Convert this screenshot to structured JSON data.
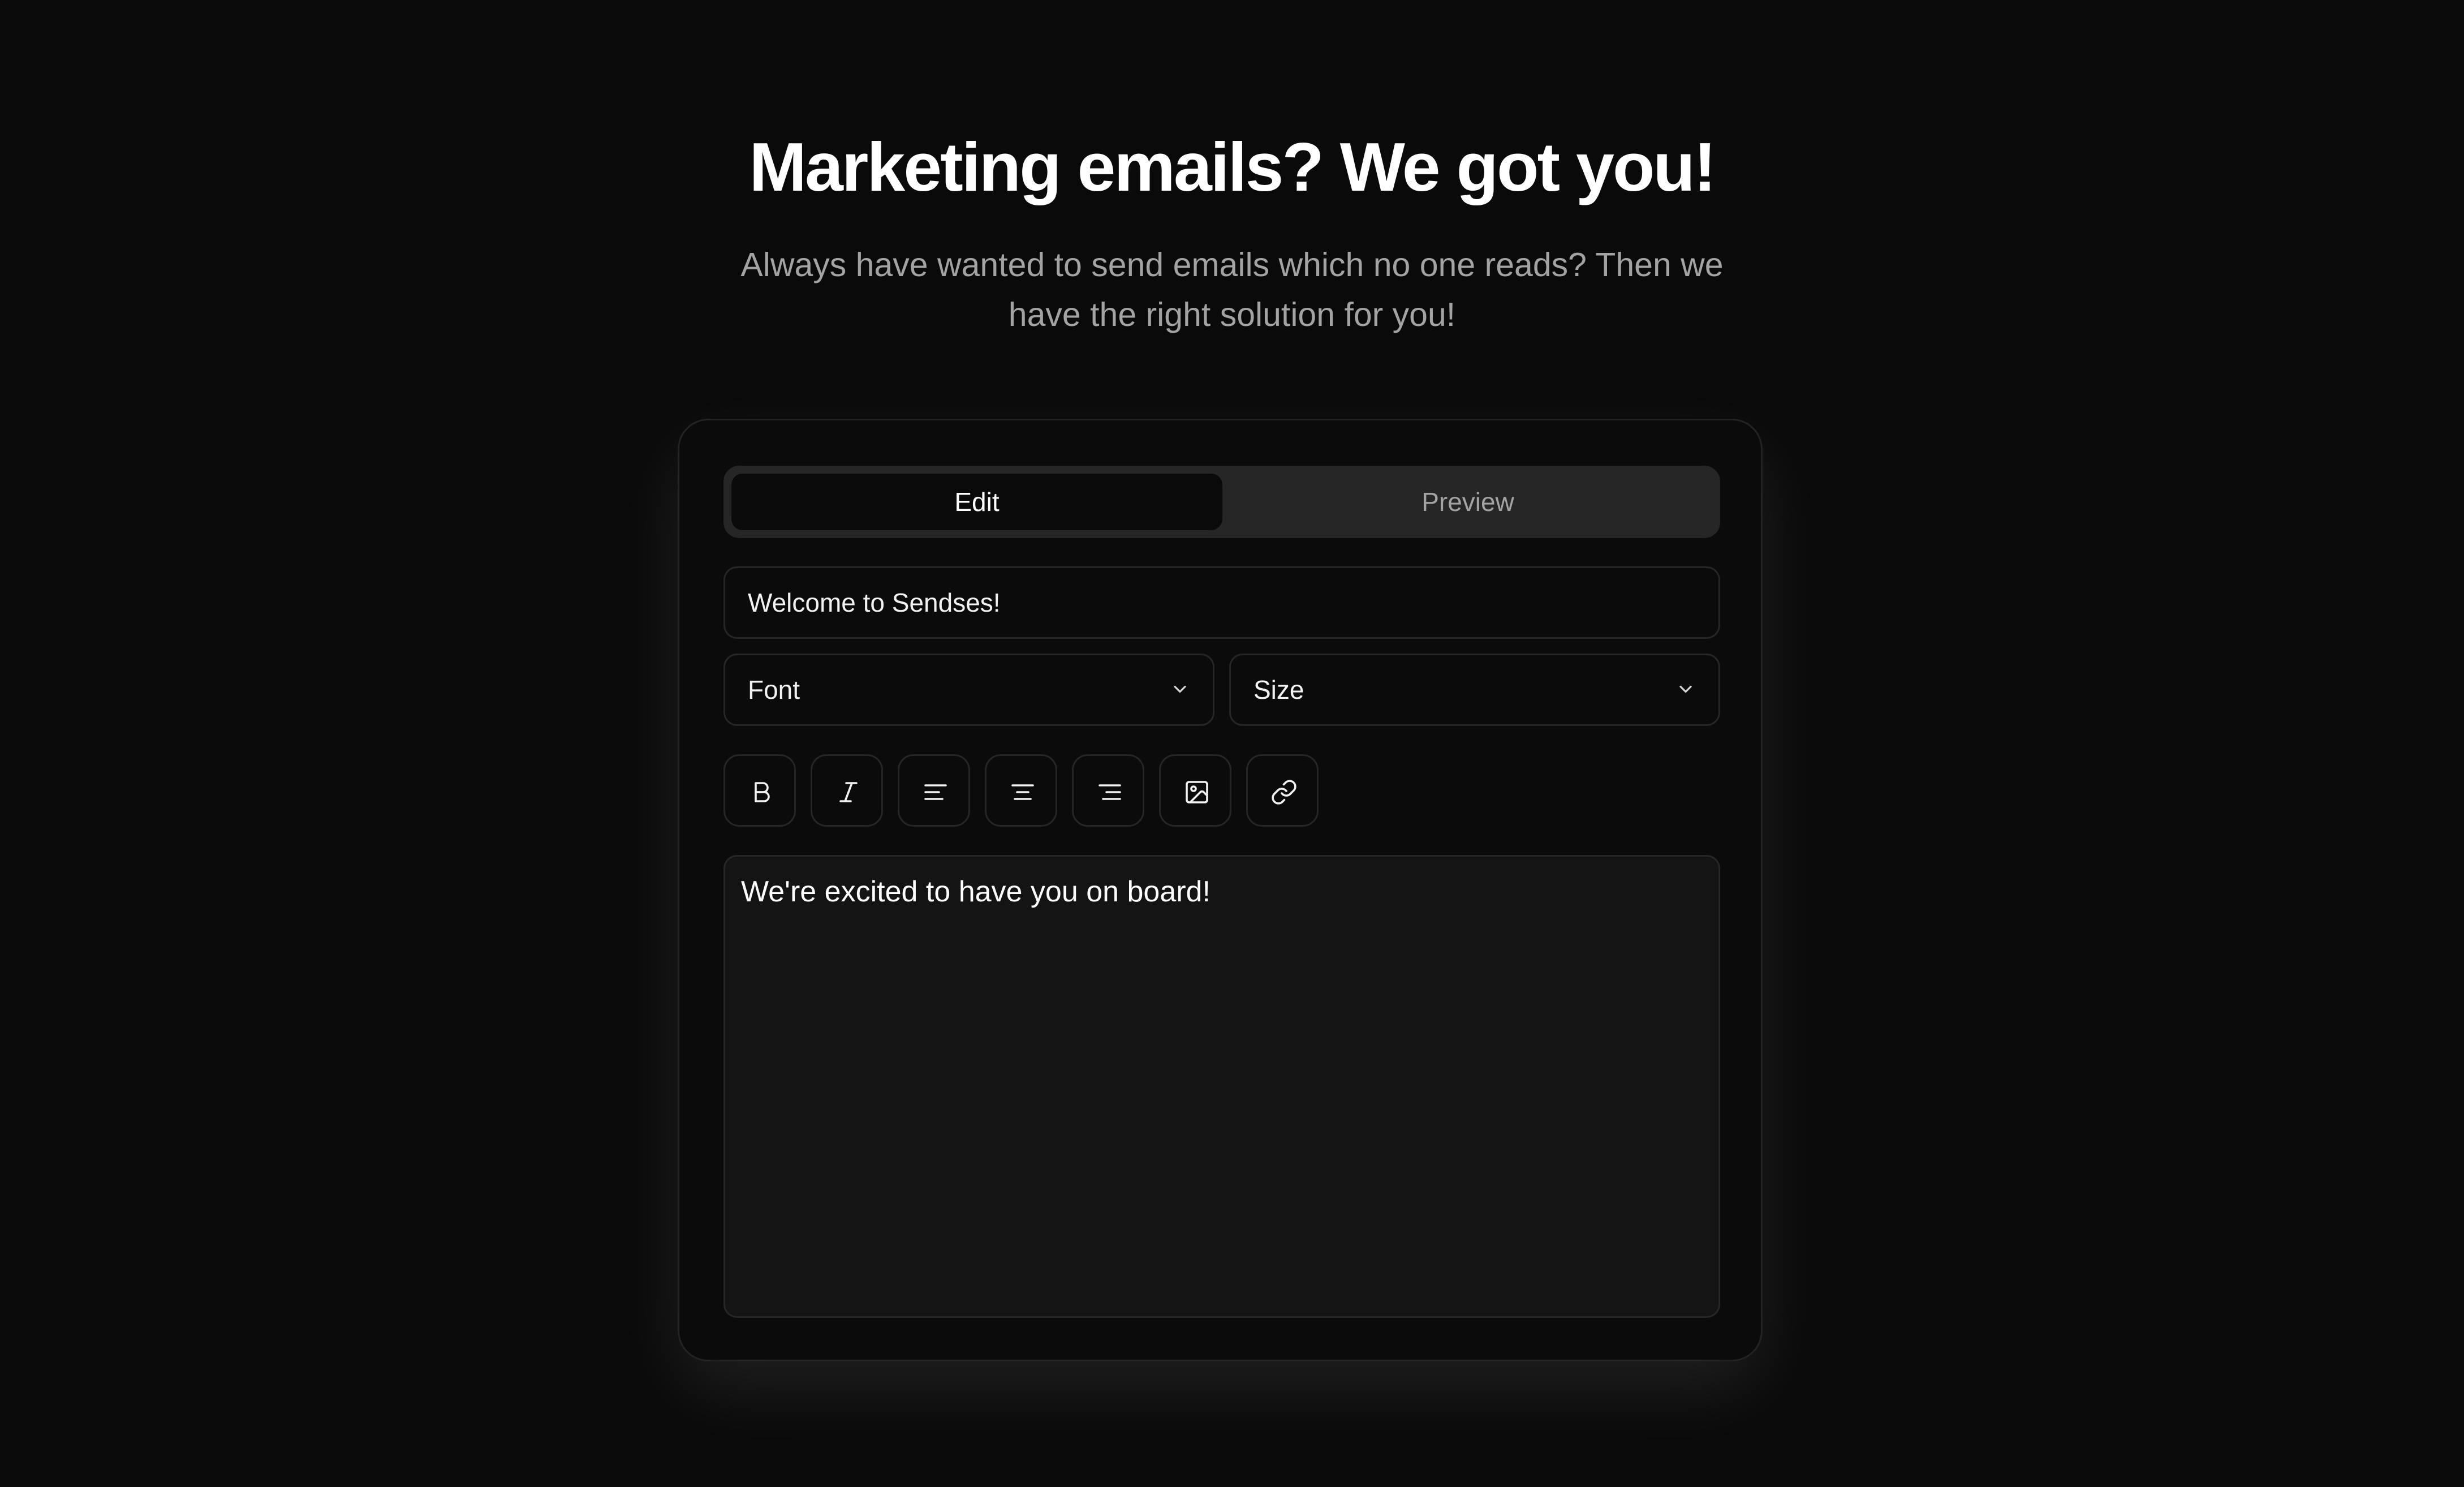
{
  "hero": {
    "title": "Marketing emails? We got you!",
    "subtitle": "Always have wanted to send emails which no one reads? Then we have the right solution for you!"
  },
  "tabs": {
    "edit": "Edit",
    "preview": "Preview",
    "active": "Edit"
  },
  "subject": {
    "value": "Welcome to Sendses!"
  },
  "selects": {
    "font": "Font",
    "size": "Size"
  },
  "toolbar": {
    "icons": [
      "bold-icon",
      "italic-icon",
      "align-left-icon",
      "align-center-icon",
      "align-right-icon",
      "image-icon",
      "link-icon"
    ]
  },
  "editor": {
    "content": "We're excited to have you on board!"
  },
  "colors": {
    "background": "#0a0a0a",
    "card": "#0b0b0b",
    "border": "#262626",
    "tab_track": "#262626",
    "editor_bg": "#141414",
    "text": "#ffffff",
    "muted": "#a3a3a3"
  }
}
